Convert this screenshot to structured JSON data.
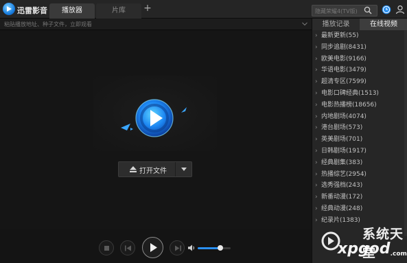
{
  "app": {
    "name": "迅雷影音",
    "tabs": [
      {
        "label": "播放器",
        "active": true
      },
      {
        "label": "片库",
        "active": false
      }
    ],
    "add_tab": "+"
  },
  "search": {
    "placeholder": "隐藏荣耀4(TV版)",
    "icon": "search-icon"
  },
  "header_icons": [
    "clock-icon",
    "user-icon"
  ],
  "url_bar": {
    "placeholder": "粘贴播放地址、种子文件，立即观看"
  },
  "player": {
    "open_file_label": "打开文件",
    "volume_level": 0.68
  },
  "panel": {
    "tabs": [
      {
        "label": "播放记录",
        "active": false
      },
      {
        "label": "在线视频",
        "active": true
      }
    ],
    "categories": [
      "最新更新(55)",
      "同步追剧(8431)",
      "欧美电影(9166)",
      "华语电影(3479)",
      "超清专区(7599)",
      "电影口碑经典(1513)",
      "电影热播榜(18656)",
      "内地剧场(4074)",
      "港台剧场(573)",
      "英美剧场(701)",
      "日韩剧场(1917)",
      "经典剧集(383)",
      "热播综艺(2954)",
      "选秀强档(243)",
      "新番动漫(172)",
      "经典动漫(248)",
      "纪录片(1383)"
    ]
  },
  "watermark": {
    "line1": "系统天堂",
    "line2": "xpgod",
    "suffix": ".com"
  },
  "colors": {
    "accent": "#2a8ff0",
    "background": "#141414",
    "panel": "#262626"
  }
}
